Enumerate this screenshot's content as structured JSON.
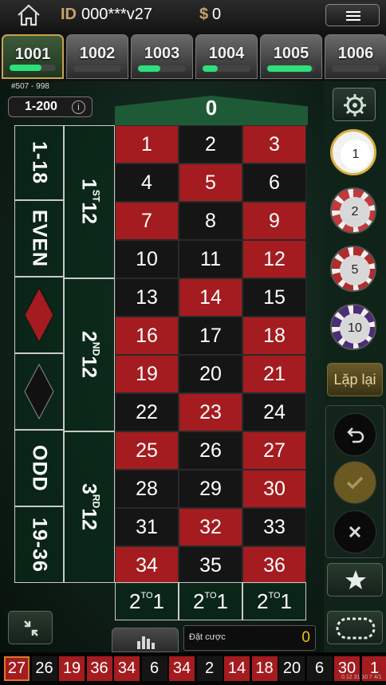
{
  "header": {
    "id_label": "ID",
    "user_id": "000***v27",
    "currency": "$",
    "balance": "0"
  },
  "tabs": [
    {
      "label": "1001",
      "progress": 0.65,
      "active": true
    },
    {
      "label": "1002",
      "progress": 0.0,
      "active": false
    },
    {
      "label": "1003",
      "progress": 0.45,
      "active": false
    },
    {
      "label": "1004",
      "progress": 0.3,
      "active": false
    },
    {
      "label": "1005",
      "progress": 0.9,
      "active": false
    },
    {
      "label": "1006",
      "progress": 0.0,
      "active": false
    }
  ],
  "table_info": {
    "round": "#507 - 998",
    "limit": "1-200",
    "info_icon": "i"
  },
  "board": {
    "zero": "0",
    "rows": [
      [
        "1",
        "2",
        "3"
      ],
      [
        "4",
        "5",
        "6"
      ],
      [
        "7",
        "8",
        "9"
      ],
      [
        "10",
        "11",
        "12"
      ],
      [
        "13",
        "14",
        "15"
      ],
      [
        "16",
        "17",
        "18"
      ],
      [
        "19",
        "20",
        "21"
      ],
      [
        "22",
        "23",
        "24"
      ],
      [
        "25",
        "26",
        "27"
      ],
      [
        "28",
        "29",
        "30"
      ],
      [
        "31",
        "32",
        "33"
      ],
      [
        "34",
        "35",
        "36"
      ]
    ],
    "colors": [
      [
        "red",
        "blk",
        "red"
      ],
      [
        "blk",
        "red",
        "blk"
      ],
      [
        "red",
        "blk",
        "red"
      ],
      [
        "blk",
        "blk",
        "red"
      ],
      [
        "blk",
        "red",
        "blk"
      ],
      [
        "red",
        "blk",
        "red"
      ],
      [
        "red",
        "blk",
        "red"
      ],
      [
        "blk",
        "red",
        "blk"
      ],
      [
        "red",
        "blk",
        "red"
      ],
      [
        "blk",
        "blk",
        "red"
      ],
      [
        "blk",
        "red",
        "blk"
      ],
      [
        "red",
        "blk",
        "red"
      ]
    ],
    "outside": {
      "low": "1-18",
      "even": "EVEN",
      "odd": "ODD",
      "high": "19-36"
    },
    "dozens": [
      {
        "num": "1",
        "suffix": "ST",
        "label": "12"
      },
      {
        "num": "2",
        "suffix": "ND",
        "label": "12"
      },
      {
        "num": "3",
        "suffix": "RD",
        "label": "12"
      }
    ],
    "columns": [
      {
        "a": "2",
        "b": "TO",
        "c": "1"
      },
      {
        "a": "2",
        "b": "TO",
        "c": "1"
      },
      {
        "a": "2",
        "b": "TO",
        "c": "1"
      }
    ]
  },
  "chips": [
    {
      "value": "1",
      "color": "#f2f2f2",
      "selected": true
    },
    {
      "value": "2",
      "color": "#c23a3a",
      "selected": false
    },
    {
      "value": "5",
      "color": "#b12c2c",
      "selected": false
    },
    {
      "value": "10",
      "color": "#4d2c7a",
      "selected": false
    }
  ],
  "controls": {
    "repeat": "Lặp lại"
  },
  "bet": {
    "label": "Đặt cược",
    "value": "0"
  },
  "history": [
    {
      "n": "27",
      "c": "first"
    },
    {
      "n": "26",
      "c": "blk"
    },
    {
      "n": "19",
      "c": "red"
    },
    {
      "n": "36",
      "c": "red"
    },
    {
      "n": "34",
      "c": "red"
    },
    {
      "n": "6",
      "c": "blk"
    },
    {
      "n": "34",
      "c": "red"
    },
    {
      "n": "2",
      "c": "blk"
    },
    {
      "n": "14",
      "c": "red"
    },
    {
      "n": "18",
      "c": "red"
    },
    {
      "n": "20",
      "c": "blk"
    },
    {
      "n": "6",
      "c": "blk"
    },
    {
      "n": "30",
      "c": "red"
    },
    {
      "n": "1",
      "c": "red"
    }
  ],
  "watermark": "0.12 31 10 7 4/1"
}
